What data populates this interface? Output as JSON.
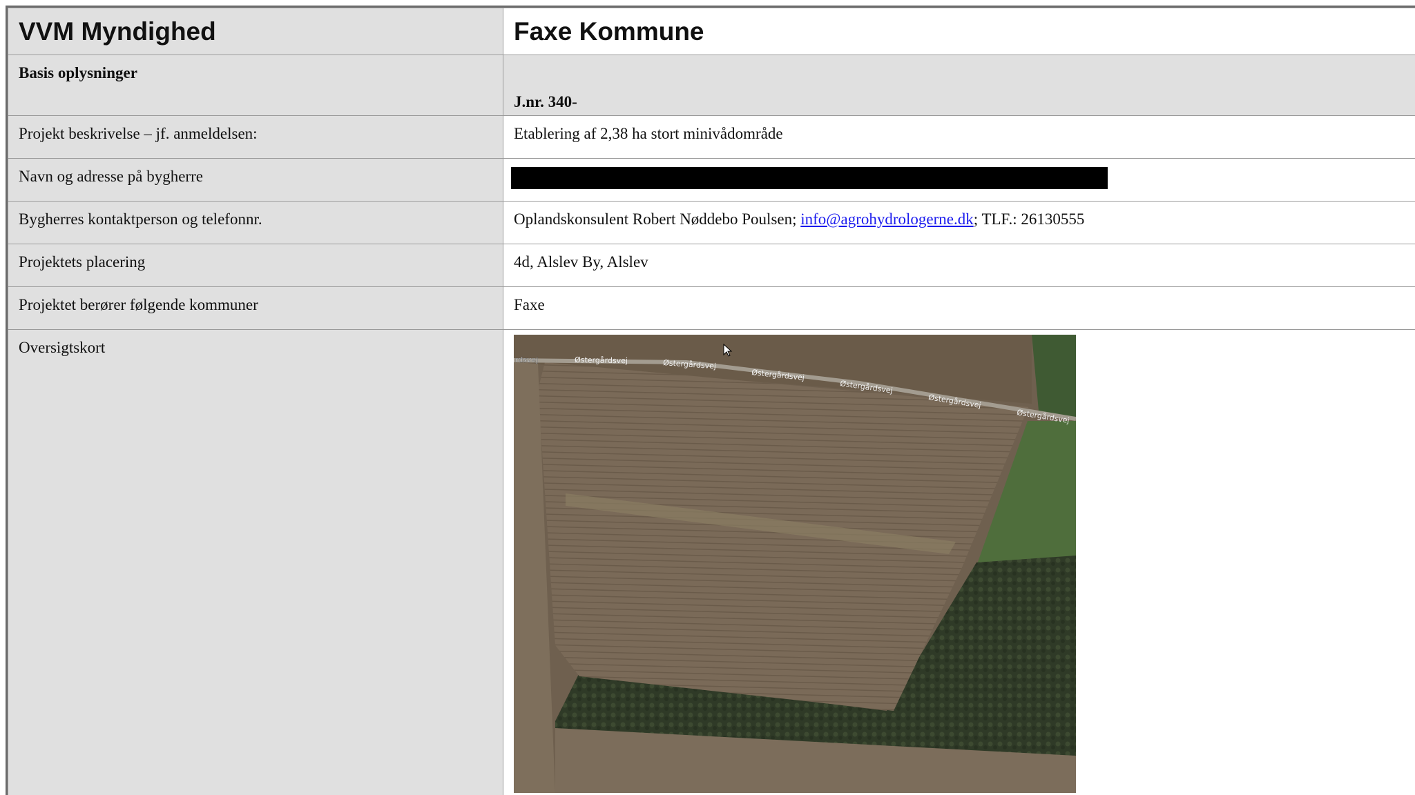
{
  "header": {
    "authority_label": "VVM Myndighed",
    "authority_value": "Faxe Kommune"
  },
  "basis": {
    "label": "Basis oplysninger",
    "journal": "J.nr. 340-"
  },
  "rows": [
    {
      "label": "Projekt beskrivelse – jf. anmeldelsen:",
      "value": "Etablering af 2,38 ha stort minivådområde"
    },
    {
      "label": "Navn og adresse på bygherre",
      "value": ""
    },
    {
      "label": "Bygherres kontaktperson og telefonnr.",
      "value_prefix": "Oplandskonsulent Robert Nøddebo Poulsen; ",
      "email": "info@agrohydrologerne.dk",
      "value_suffix": "; TLF.: 26130555"
    },
    {
      "label": "Projektets placering",
      "value": "4d, Alslev By, Alslev"
    },
    {
      "label": "Projektet berører følgende kommuner",
      "value": "Faxe"
    },
    {
      "label": "Oversigtskort",
      "value": ""
    }
  ],
  "map": {
    "road_label": "Østergårdsvej",
    "road_label_partial": "rdsvej",
    "colors": {
      "field": "#7a6a58",
      "field_dark": "#5f5143",
      "forest": "#2f3a27",
      "grass": "#4f6e3c",
      "road": "#a39c90"
    }
  }
}
